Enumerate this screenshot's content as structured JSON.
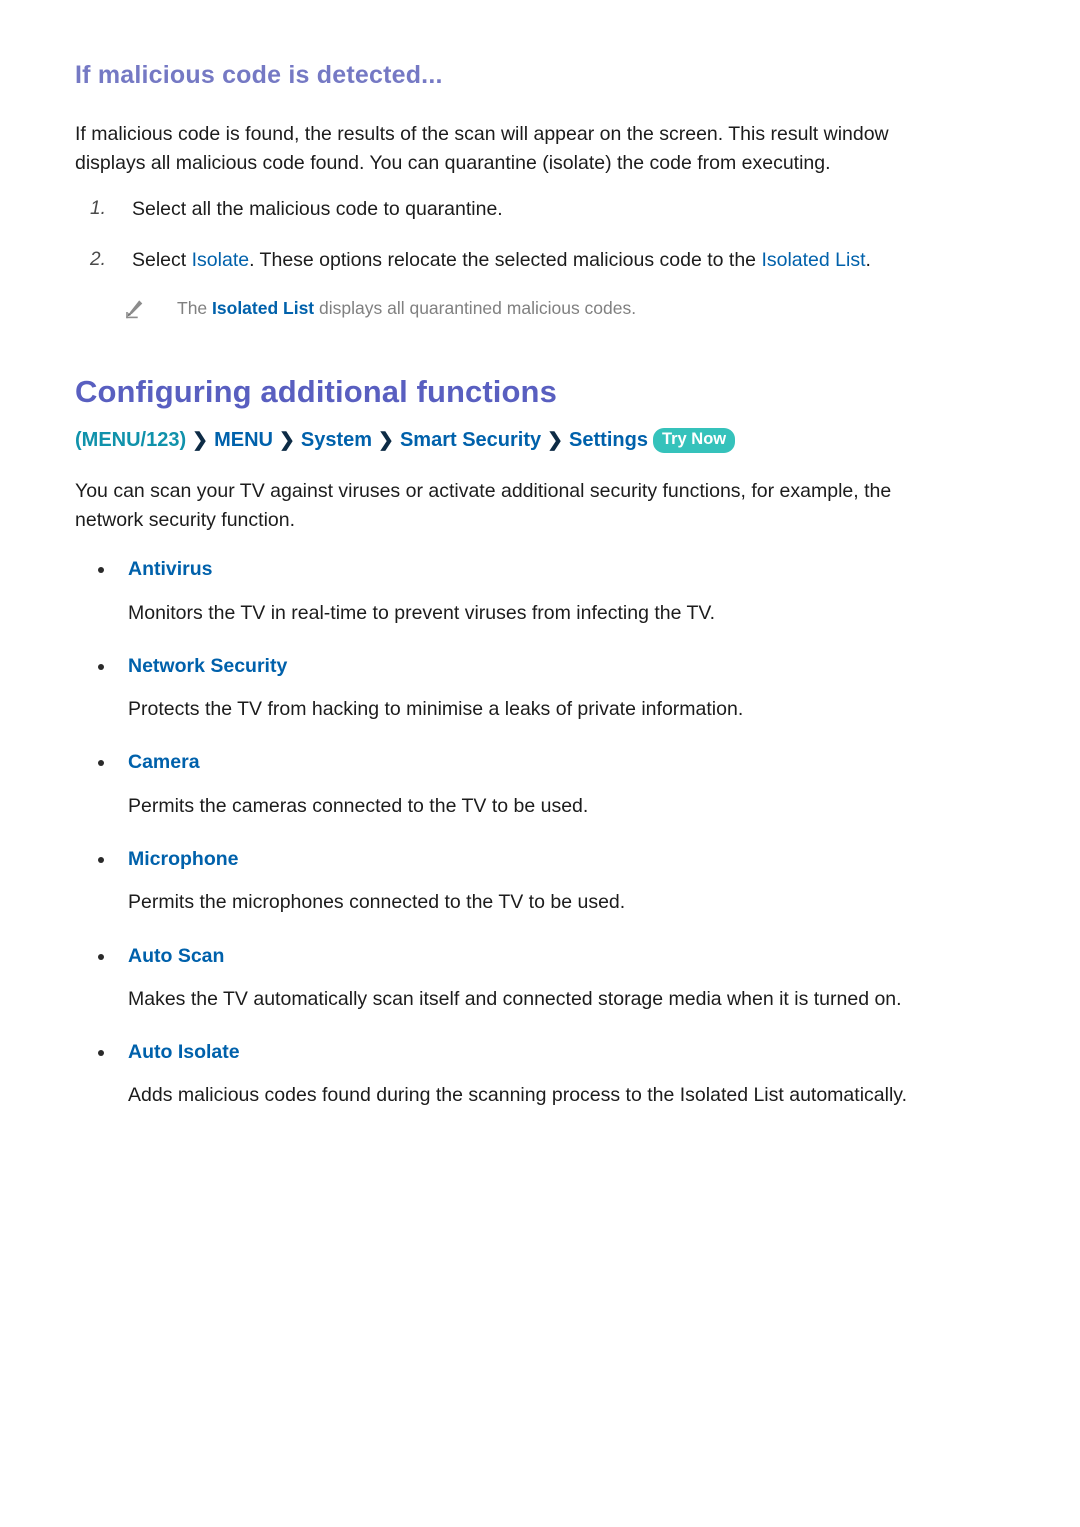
{
  "document": {
    "sub_heading": "If malicious code is detected...",
    "intro_paragraph": "If malicious code is found, the results of the scan will appear on the screen. This result window displays all malicious code found. You can quarantine (isolate) the code from executing.",
    "steps": [
      {
        "number": "1.",
        "text_parts": [
          {
            "text": "Select all the malicious code to quarantine.",
            "style": "normal"
          }
        ]
      },
      {
        "number": "2.",
        "text_parts": [
          {
            "text": "Select ",
            "style": "normal"
          },
          {
            "text": "Isolate",
            "style": "link"
          },
          {
            "text": ". These options relocate the selected malicious code to the ",
            "style": "normal"
          },
          {
            "text": "Isolated List",
            "style": "link"
          },
          {
            "text": ".",
            "style": "normal"
          }
        ]
      }
    ],
    "note": {
      "icon": "pencil-icon",
      "parts": [
        {
          "text": "The ",
          "style": "normal"
        },
        {
          "text": "Isolated List",
          "style": "link-bold"
        },
        {
          "text": " displays all quarantined malicious codes.",
          "style": "normal"
        }
      ]
    },
    "main_heading": "Configuring additional functions",
    "breadcrumb": {
      "root": "(MENU/123)",
      "separator": "❯",
      "segments": [
        "MENU",
        "System",
        "Smart Security",
        "Settings"
      ],
      "badge": "Try Now"
    },
    "section_paragraph": "You can scan your TV against viruses or activate additional security functions, for example, the network security function.",
    "features": [
      {
        "label": "Antivirus",
        "description": "Monitors the TV in real-time to prevent viruses from infecting the TV."
      },
      {
        "label": "Network Security",
        "description": "Protects the TV from hacking to minimise a leaks of private information."
      },
      {
        "label": "Camera",
        "description": "Permits the cameras connected to the TV to be used."
      },
      {
        "label": "Microphone",
        "description": "Permits the microphones connected to the TV to be used."
      },
      {
        "label": "Auto Scan",
        "description": "Makes the TV automatically scan itself and connected storage media when it is turned on."
      },
      {
        "label": "Auto Isolate",
        "description": "Adds malicious codes found during the scanning process to the Isolated List automatically."
      }
    ]
  },
  "colors": {
    "sub_heading": "#7579c4",
    "main_heading": "#595fc0",
    "link_blue": "#0061ab",
    "teal": "#1092ab",
    "badge_bg": "#35c2bb",
    "note_grey": "#808080",
    "body_text": "#1c1c1c"
  }
}
